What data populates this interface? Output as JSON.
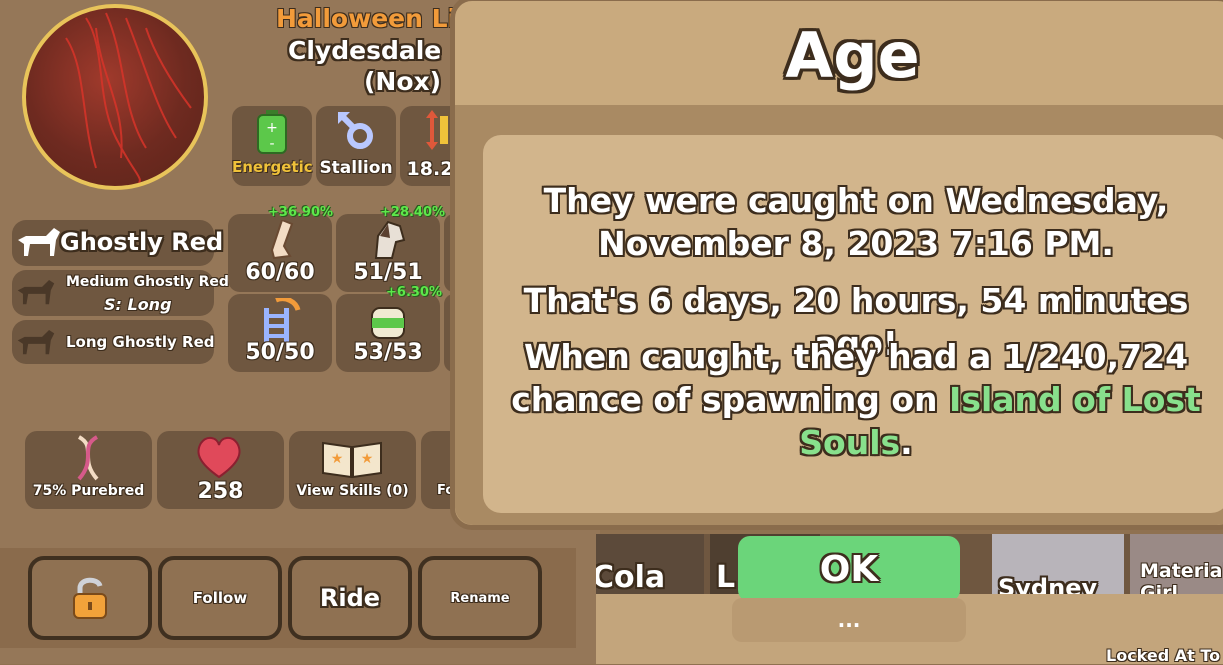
{
  "horse": {
    "event_title": "Halloween Li",
    "breed": "Clydesdale H",
    "name": "(Nox)",
    "traits": [
      {
        "label": "Energetic",
        "icon": "battery-icon"
      },
      {
        "label": "Stallion",
        "icon": "male-symbol-icon"
      },
      {
        "label": "18.2",
        "icon": "height-icon"
      }
    ],
    "coat_main": "Ghostly Red",
    "coat_second": "Medium Ghostly Red",
    "coat_second_sub": "S: Long",
    "coat_third": "Long Ghostly Red",
    "stats": [
      {
        "value": "60/60",
        "bonus": "+36.90%",
        "icon": "leg-icon"
      },
      {
        "value": "51/51",
        "bonus": "+28.40%",
        "icon": "horse-head-icon"
      },
      {
        "value": "50/50",
        "bonus": "",
        "icon": "ladder-icon"
      },
      {
        "value": "53/53",
        "bonus": "+6.30%",
        "icon": "bandage-icon"
      }
    ],
    "info_tiles": [
      {
        "label": "75% Purebred",
        "icon": "dna-icon"
      },
      {
        "label": "258",
        "icon": "heart-icon"
      },
      {
        "label": "View Skills (0)",
        "icon": "book-icon"
      },
      {
        "label": "Fo",
        "icon": "food-icon"
      }
    ],
    "actions": {
      "lock": "lock-icon",
      "follow": "Follow",
      "ride": "Ride",
      "rename": "Rename"
    }
  },
  "strip": {
    "names": [
      "Cola",
      "L",
      "Sydney",
      "Material Girl"
    ],
    "locked_text": "Locked At To"
  },
  "modal": {
    "title": "Age",
    "line1": "They were caught on Wednesday,",
    "line2": "November 8, 2023 7:16 PM.",
    "line3": "That's 6 days, 20 hours, 54 minutes ago!",
    "line4": "When caught, they had a 1/240,724",
    "line5_prefix": "chance of spawning on ",
    "location_part1": "Island of Lost",
    "location_part2": "Souls",
    "line6_suffix": ".",
    "ok_label": "OK",
    "dots_label": "..."
  },
  "colors": {
    "accent_orange": "#f29b3a",
    "ok_green": "#6bd57a",
    "location_green": "#88e08c",
    "bonus_green": "#5de84a"
  }
}
